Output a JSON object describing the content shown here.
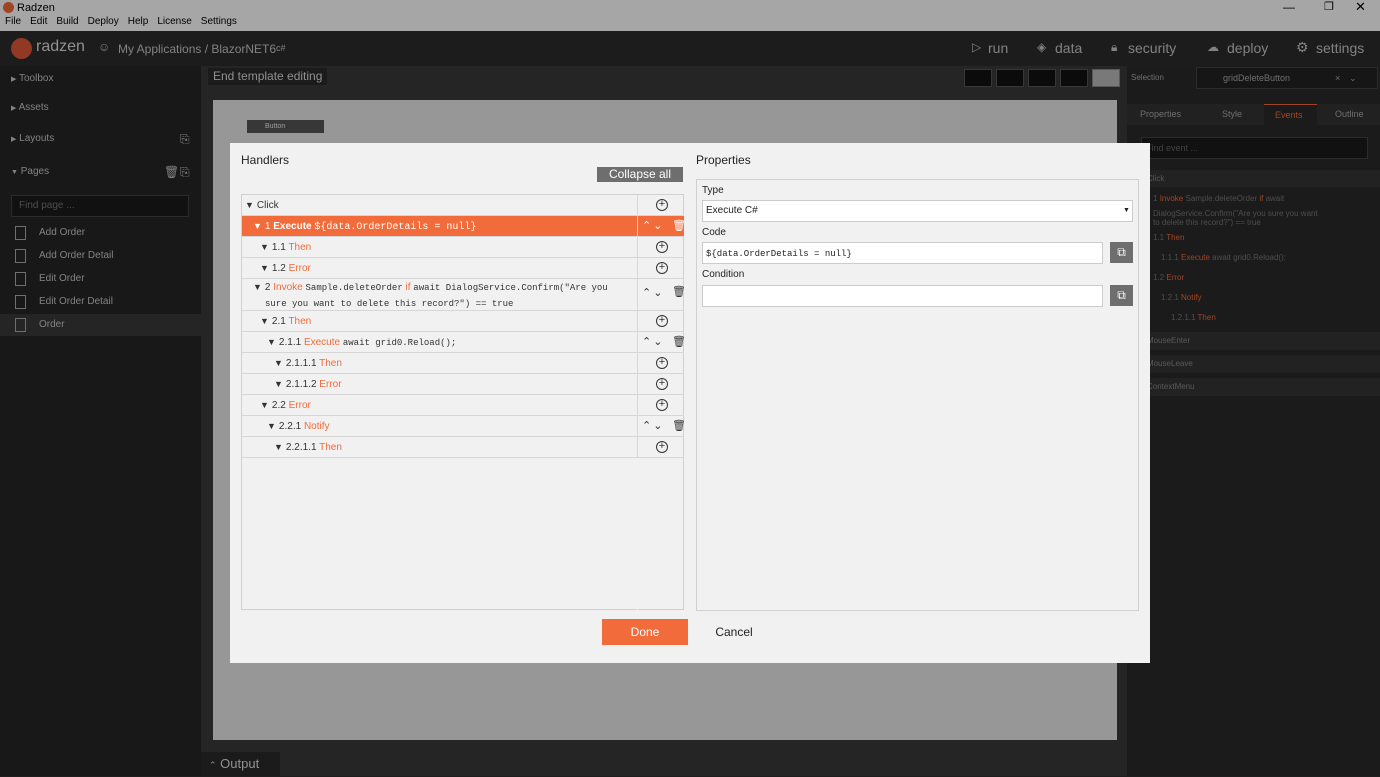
{
  "window": {
    "title": "Radzen"
  },
  "menu": [
    "File",
    "Edit",
    "Build",
    "Deploy",
    "Help",
    "License",
    "Settings"
  ],
  "header": {
    "logo": "radzen",
    "breadcrumb": "My Applications / BlazorNET6",
    "badge": "c#",
    "nav": {
      "run": "run",
      "data": "data",
      "security": "security",
      "deploy": "deploy",
      "settings": "settings"
    }
  },
  "sidebar": {
    "toolbox": "Toolbox",
    "assets": "Assets",
    "layouts": "Layouts",
    "pages": "Pages",
    "find_placeholder": "Find page ...",
    "items": [
      "Add Order",
      "Add Order Detail",
      "Edit Order",
      "Edit Order Detail",
      "Order"
    ]
  },
  "canvas": {
    "end_template": "End template editing",
    "button_tag": "Button",
    "output": "Output"
  },
  "right": {
    "selection_label": "Selection",
    "selection_value": "gridDeleteButton",
    "tabs": [
      "Properties",
      "Style",
      "Events",
      "Outline"
    ],
    "find_placeholder": "Find event ...",
    "click": "Click",
    "lines": [
      {
        "id": "1",
        "kw": "Invoke",
        "text": "Sample.deleteOrder",
        "kw2": "if",
        "text2": "await"
      },
      {
        "text": "DialogService.Confirm(\"Are you sure you want"
      },
      {
        "text": "to delete this record?\") == true"
      },
      {
        "id": "1.1",
        "kw": "Then"
      },
      {
        "id": "1.1.1",
        "kw": "Execute",
        "text": "await grid0.Reload();"
      },
      {
        "id": "1.2",
        "kw": "Error"
      },
      {
        "id": "1.2.1",
        "kw": "Notify"
      },
      {
        "id": "1.2.1.1",
        "kw": "Then"
      }
    ],
    "events": [
      "MouseEnter",
      "MouseLeave",
      "ContextMenu"
    ]
  },
  "dialog": {
    "handlers_title": "Handlers",
    "collapse_all": "Collapse all",
    "properties_title": "Properties",
    "root": "Click",
    "rows": [
      {
        "id": "1",
        "kw": "Execute",
        "code": "${data.OrderDetails = null}"
      },
      {
        "id": "1.1",
        "kw": "Then"
      },
      {
        "id": "1.2",
        "kw": "Error"
      },
      {
        "id": "2",
        "kw": "Invoke",
        "code": "Sample.deleteOrder",
        "kw2": "if",
        "code2": "await DialogService.Confirm(\"Are you",
        "code3": "sure you want to delete this record?\") == true"
      },
      {
        "id": "2.1",
        "kw": "Then"
      },
      {
        "id": "2.1.1",
        "kw": "Execute",
        "code": "await grid0.Reload();"
      },
      {
        "id": "2.1.1.1",
        "kw": "Then"
      },
      {
        "id": "2.1.1.2",
        "kw": "Error"
      },
      {
        "id": "2.2",
        "kw": "Error"
      },
      {
        "id": "2.2.1",
        "kw": "Notify"
      },
      {
        "id": "2.2.1.1",
        "kw": "Then"
      }
    ],
    "type_label": "Type",
    "type_value": "Execute C#",
    "code_label": "Code",
    "code_value": "${data.OrderDetails = null}",
    "condition_label": "Condition",
    "condition_value": "",
    "done": "Done",
    "cancel": "Cancel"
  },
  "colors": {
    "accent": "#f26b3a",
    "selected_row": "#f26b3a"
  }
}
